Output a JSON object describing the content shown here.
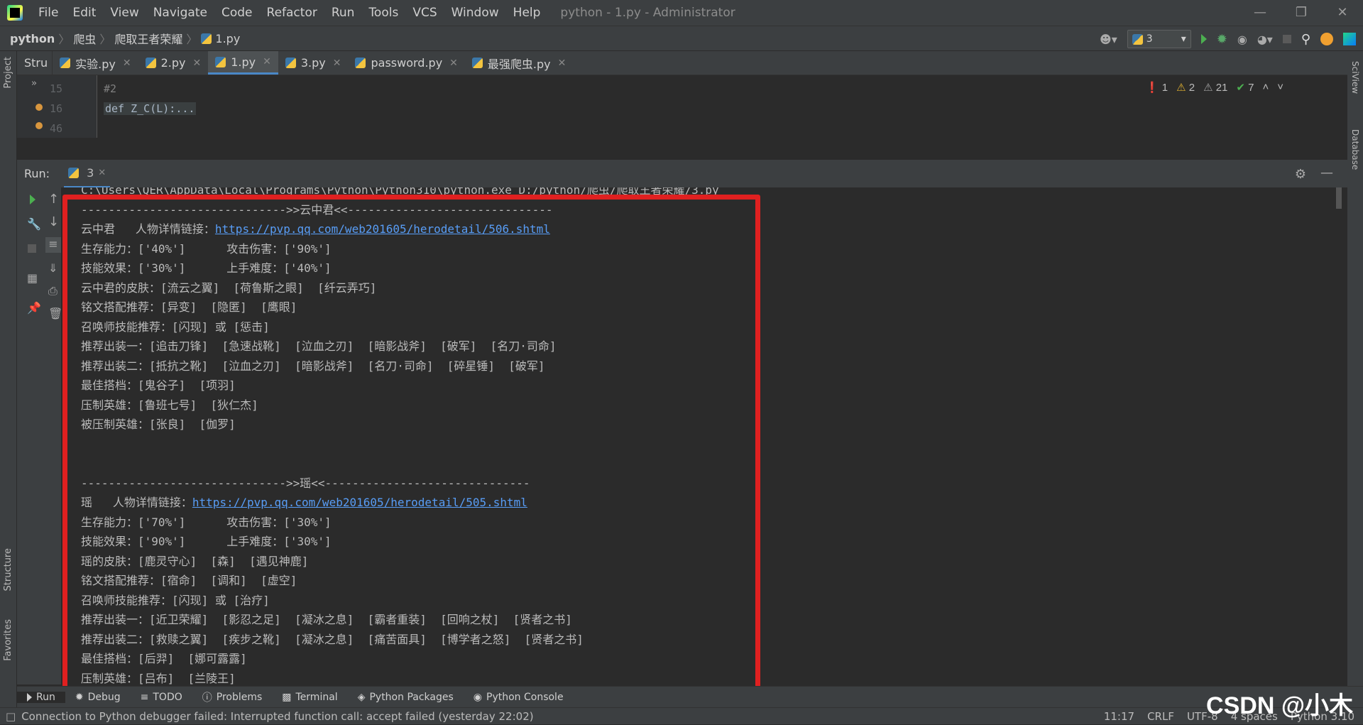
{
  "titlebar": {
    "menu": [
      "File",
      "Edit",
      "View",
      "Navigate",
      "Code",
      "Refactor",
      "Run",
      "Tools",
      "VCS",
      "Window",
      "Help"
    ],
    "title": "python - 1.py - Administrator"
  },
  "navbar": {
    "breadcrumb": [
      "python",
      "爬虫",
      "爬取王者荣耀",
      "1.py"
    ],
    "run_config": "3"
  },
  "tabs": {
    "structure_label": "Stru",
    "items": [
      {
        "label": "实验.py"
      },
      {
        "label": "2.py"
      },
      {
        "label": "1.py",
        "active": true
      },
      {
        "label": "3.py"
      },
      {
        "label": "password.py"
      },
      {
        "label": "最强爬虫.py"
      }
    ]
  },
  "editor": {
    "lines": [
      {
        "num": "15",
        "code": "#2"
      },
      {
        "num": "16",
        "code": "def Z_C(L):..."
      },
      {
        "num": "46",
        "code": ""
      }
    ],
    "inspections": {
      "errors": "1",
      "warnings": "2",
      "weak_warnings": "21",
      "typos": "7"
    }
  },
  "run_panel": {
    "label": "Run:",
    "tab": "3"
  },
  "console": {
    "lines": [
      {
        "text": "C:\\Users\\QER\\AppData\\Local\\Programs\\Python\\Python310\\python.exe D:/python/爬虫/爬取王者荣耀/3.py"
      },
      {
        "text": "------------------------------>>云中君<<------------------------------"
      },
      {
        "text": "云中君   人物详情链接：",
        "link": "https://pvp.qq.com/web201605/herodetail/506.shtml"
      },
      {
        "text": "生存能力：['40%']      攻击伤害：['90%']"
      },
      {
        "text": "技能效果：['30%']      上手难度：['40%']"
      },
      {
        "text": "云中君的皮肤：[流云之翼]  [荷鲁斯之眼]  [纤云弄巧]"
      },
      {
        "text": "铭文搭配推荐：[异变]  [隐匿]  [鹰眼]"
      },
      {
        "text": "召唤师技能推荐：[闪现] 或 [惩击]"
      },
      {
        "text": "推荐出装一：[追击刀锋]  [急速战靴]  [泣血之刃]  [暗影战斧]  [破军]  [名刀·司命]"
      },
      {
        "text": "推荐出装二：[抵抗之靴]  [泣血之刃]  [暗影战斧]  [名刀·司命]  [碎星锤]  [破军]"
      },
      {
        "text": "最佳搭档：[鬼谷子]  [项羽]"
      },
      {
        "text": "压制英雄：[鲁班七号]  [狄仁杰]"
      },
      {
        "text": "被压制英雄：[张良]  [伽罗]"
      },
      {
        "text": ""
      },
      {
        "text": ""
      },
      {
        "text": "------------------------------>>瑶<<------------------------------"
      },
      {
        "text": "瑶   人物详情链接：",
        "link": "https://pvp.qq.com/web201605/herodetail/505.shtml"
      },
      {
        "text": "生存能力：['70%']      攻击伤害：['30%']"
      },
      {
        "text": "技能效果：['90%']      上手难度：['30%']"
      },
      {
        "text": "瑶的皮肤：[鹿灵守心]  [森]  [遇见神鹿]"
      },
      {
        "text": "铭文搭配推荐：[宿命]  [调和]  [虚空]"
      },
      {
        "text": "召唤师技能推荐：[闪现] 或 [治疗]"
      },
      {
        "text": "推荐出装一：[近卫荣耀]  [影忍之足]  [凝冰之息]  [霸者重装]  [回响之杖]  [贤者之书]"
      },
      {
        "text": "推荐出装二：[救赎之翼]  [疾步之靴]  [凝冰之息]  [痛苦面具]  [博学者之怒]  [贤者之书]"
      },
      {
        "text": "最佳搭档：[后羿]  [娜可露露]"
      },
      {
        "text": "压制英雄：[吕布]  [兰陵王]"
      }
    ]
  },
  "left_strip": {
    "project": "Project",
    "structure": "Structure",
    "favorites": "Favorites"
  },
  "right_strip": {
    "sciview": "SciView",
    "database": "Database"
  },
  "bottom_tabs": [
    "Run",
    "Debug",
    "TODO",
    "Problems",
    "Terminal",
    "Python Packages",
    "Python Console"
  ],
  "status": {
    "message": "Connection to Python debugger failed: Interrupted function call: accept failed (yesterday 22:02)",
    "position": "11:17",
    "line_sep": "CRLF",
    "encoding": "UTF-8",
    "indent": "4 spaces",
    "interpreter": "Python 3.10"
  },
  "watermark": "CSDN @小木",
  "colors": {
    "accent_red": "#e02020",
    "link": "#589df6",
    "keyword": "#cc7832",
    "function": "#ffc66d"
  }
}
